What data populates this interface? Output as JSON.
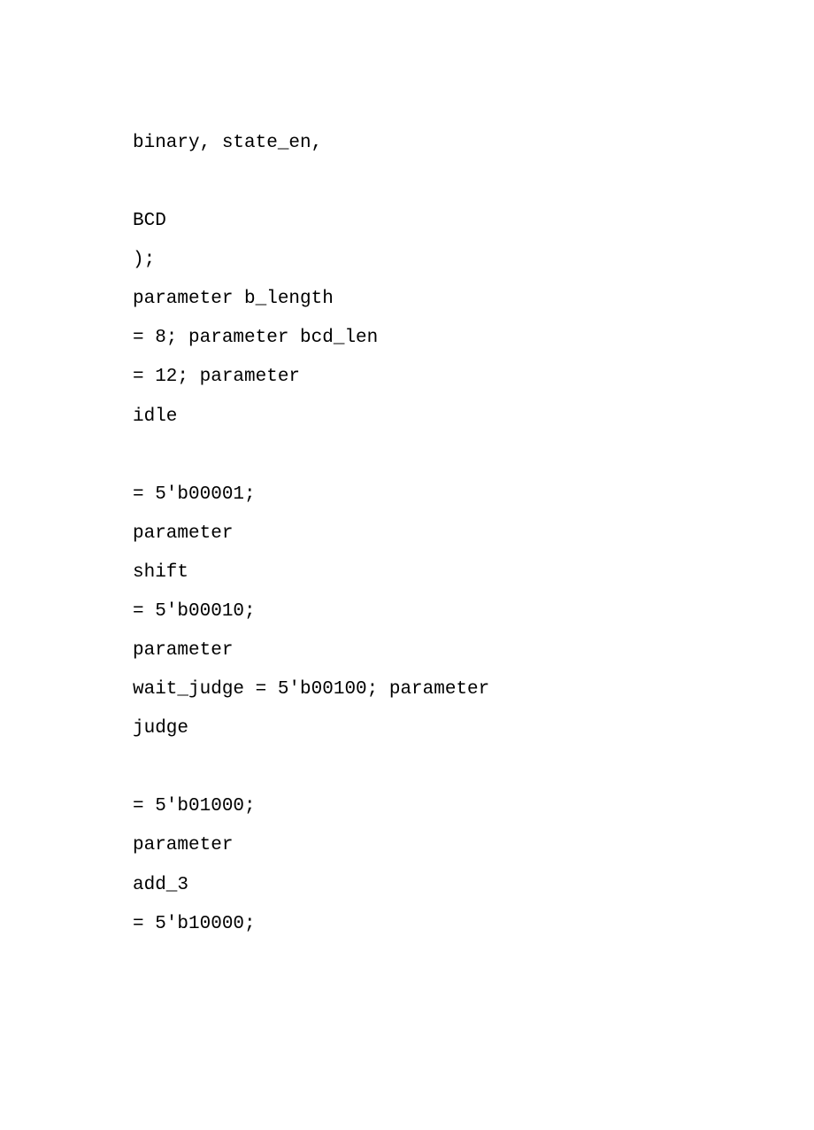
{
  "code": {
    "lines": [
      "binary, state_en,",
      "",
      "BCD",
      ");",
      "parameter b_length",
      "= 8; parameter bcd_len",
      "= 12; parameter",
      "idle",
      "",
      "= 5'b00001;",
      "parameter",
      "shift",
      "= 5'b00010;",
      "parameter",
      "wait_judge = 5'b00100; parameter",
      "judge",
      "",
      "= 5'b01000;",
      "parameter",
      "add_3",
      "= 5'b10000;"
    ]
  }
}
